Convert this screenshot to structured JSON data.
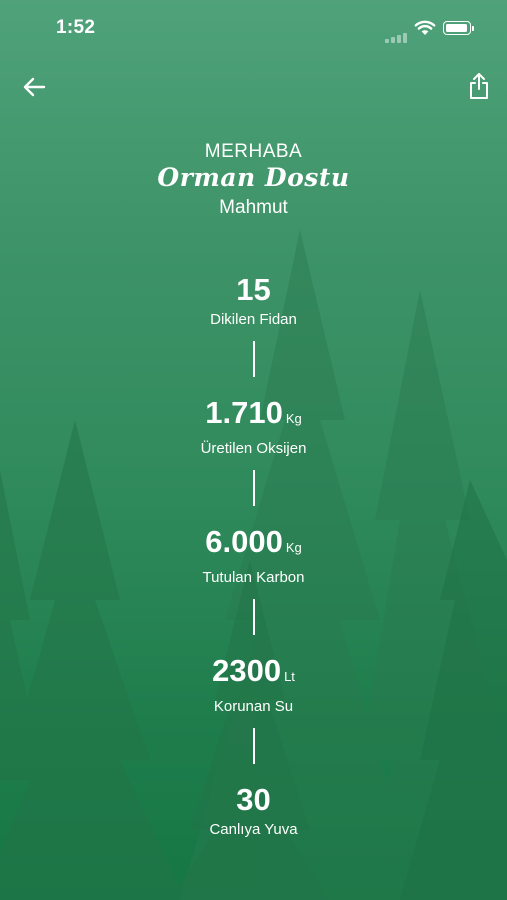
{
  "status_bar": {
    "time": "1:52"
  },
  "header": {
    "greeting": "MERHABA",
    "title": "Orman Dostu",
    "user_name": "Mahmut"
  },
  "stats": [
    {
      "value": "15",
      "unit": "",
      "label": "Dikilen Fidan"
    },
    {
      "value": "1.710",
      "unit": "Kg",
      "label": "Üretilen Oksijen"
    },
    {
      "value": "6.000",
      "unit": "Kg",
      "label": "Tutulan Karbon"
    },
    {
      "value": "2300",
      "unit": "Lt",
      "label": "Korunan Su"
    },
    {
      "value": "30",
      "unit": "",
      "label": "Canlıya Yuva"
    }
  ],
  "icons": {
    "back": "arrow-left-icon",
    "share": "share-icon"
  },
  "colors": {
    "background_top": "#4fa27a",
    "background_bottom": "#157744",
    "text": "#ffffff"
  }
}
